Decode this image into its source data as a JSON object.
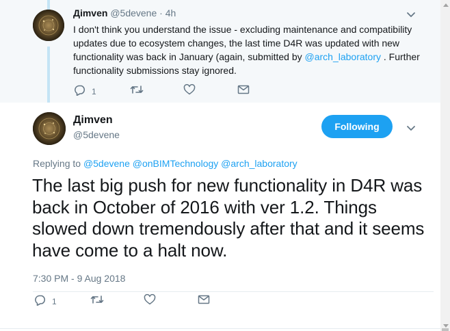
{
  "parent_tweet": {
    "display_name": "Дimven",
    "handle": "@5devene",
    "separator": "·",
    "time": "4h",
    "text_before_link": "I don't think you understand the issue - excluding maintenance and compatibility updates due to ecosystem changes, the last time D4R was updated with new functionality was back in January (again, submitted by ",
    "mention": "@arch_laboratory",
    "text_after_link": " . Further functionality submissions stay ignored.",
    "reply_count": "1",
    "icons": [
      "reply-icon",
      "retweet-icon",
      "like-icon",
      "direct-message-icon",
      "chevron-down-icon"
    ]
  },
  "main_tweet": {
    "display_name": "Дimven",
    "handle": "@5devene",
    "follow_label": "Following",
    "replying_prefix": "Replying to",
    "replying_mentions": [
      "@5devene",
      "@onBIMTechnology",
      "@arch_laboratory"
    ],
    "text": "The last big push for new functionality in D4R was back in October of 2016 with ver 1.2. Things slowed down tremendously after that and it seems have come to a halt now.",
    "timestamp": "7:30 PM - 9 Aug 2018",
    "reply_count": "1"
  },
  "colors": {
    "accent": "#1da1f2",
    "secondary_text": "#657786",
    "parent_background": "#f5f8fa",
    "thread_line": "#c4e4f5"
  }
}
